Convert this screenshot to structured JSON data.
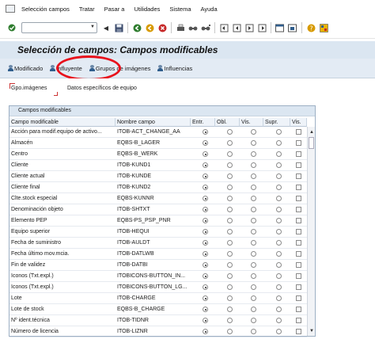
{
  "menu": {
    "items": [
      "Selección campos",
      "Tratar",
      "Pasar a",
      "Utilidades",
      "Sistema",
      "Ayuda"
    ]
  },
  "toolbar": {
    "command_field_value": "",
    "icons": [
      "enter-icon",
      "back-icon",
      "save-icon",
      "back-icon",
      "exit-icon",
      "cancel-icon",
      "print-icon",
      "find-icon",
      "find-next-icon",
      "first-page-icon",
      "prev-page-icon",
      "next-page-icon",
      "last-page-icon",
      "new-session-icon",
      "shortcut-icon",
      "help-icon",
      "layout-icon"
    ]
  },
  "title": "Selección de campos: Campos modificables",
  "app_toolbar": {
    "buttons": [
      "Modificado",
      "Influyente",
      "Grupos de imágenes",
      "Influencias"
    ]
  },
  "sub": {
    "group_label": "Gpo.imágenes",
    "group_desc": "Datos específicos de equipo"
  },
  "grid": {
    "title": "Campos modificables",
    "columns": [
      "Campo modificable",
      "Nombre campo",
      "Entr.",
      "Obl.",
      "Vis.",
      "Supr.",
      "Vis."
    ],
    "rows": [
      {
        "field": "Acción para modif.equipo de activo...",
        "name": "ITOB-ACT_CHANGE_AA",
        "selected": "Entr."
      },
      {
        "field": "Almacén",
        "name": "EQBS-B_LAGER",
        "selected": "Entr."
      },
      {
        "field": "Centro",
        "name": "EQBS-B_WERK",
        "selected": "Entr."
      },
      {
        "field": "Cliente",
        "name": "ITOB-KUND1",
        "selected": "Entr."
      },
      {
        "field": "Cliente actual",
        "name": "ITOB-KUNDE",
        "selected": "Entr."
      },
      {
        "field": "Cliente final",
        "name": "ITOB-KUND2",
        "selected": "Entr."
      },
      {
        "field": "Clte.stock especial",
        "name": "EQBS-KUNNR",
        "selected": "Entr."
      },
      {
        "field": "Denominación objeto",
        "name": "ITOB-SHTXT",
        "selected": "Entr."
      },
      {
        "field": "Elemento PEP",
        "name": "EQBS-PS_PSP_PNR",
        "selected": "Entr."
      },
      {
        "field": "Equipo superior",
        "name": "ITOB-HEQUI",
        "selected": "Entr."
      },
      {
        "field": "Fecha de suministro",
        "name": "ITOB-AULDT",
        "selected": "Entr."
      },
      {
        "field": "Fecha último mov.mcia.",
        "name": "ITOB-DATLWB",
        "selected": "Entr."
      },
      {
        "field": "Fin de validez",
        "name": "ITOB-DATBI",
        "selected": "Entr."
      },
      {
        "field": "Iconos (Txt.expl.)",
        "name": "ITOBICONS-BUTTON_IN...",
        "selected": "Entr."
      },
      {
        "field": "Iconos (Txt.expl.)",
        "name": "ITOBICONS-BUTTON_LG...",
        "selected": "Entr."
      },
      {
        "field": "Lote",
        "name": "ITOB-CHARGE",
        "selected": "Entr."
      },
      {
        "field": "Lote de stock",
        "name": "EQBS-B_CHARGE",
        "selected": "Entr."
      },
      {
        "field": "Nº ident.técnica",
        "name": "ITOB-TIDNR",
        "selected": "Entr."
      },
      {
        "field": "Número de licencia",
        "name": "ITOB-LIZNR",
        "selected": "Entr."
      }
    ]
  },
  "colors": {
    "title_bg": "#dbe6f1",
    "app_toolbar_bg": "#e3ebf4",
    "highlight_ellipse": "#e8101b"
  }
}
